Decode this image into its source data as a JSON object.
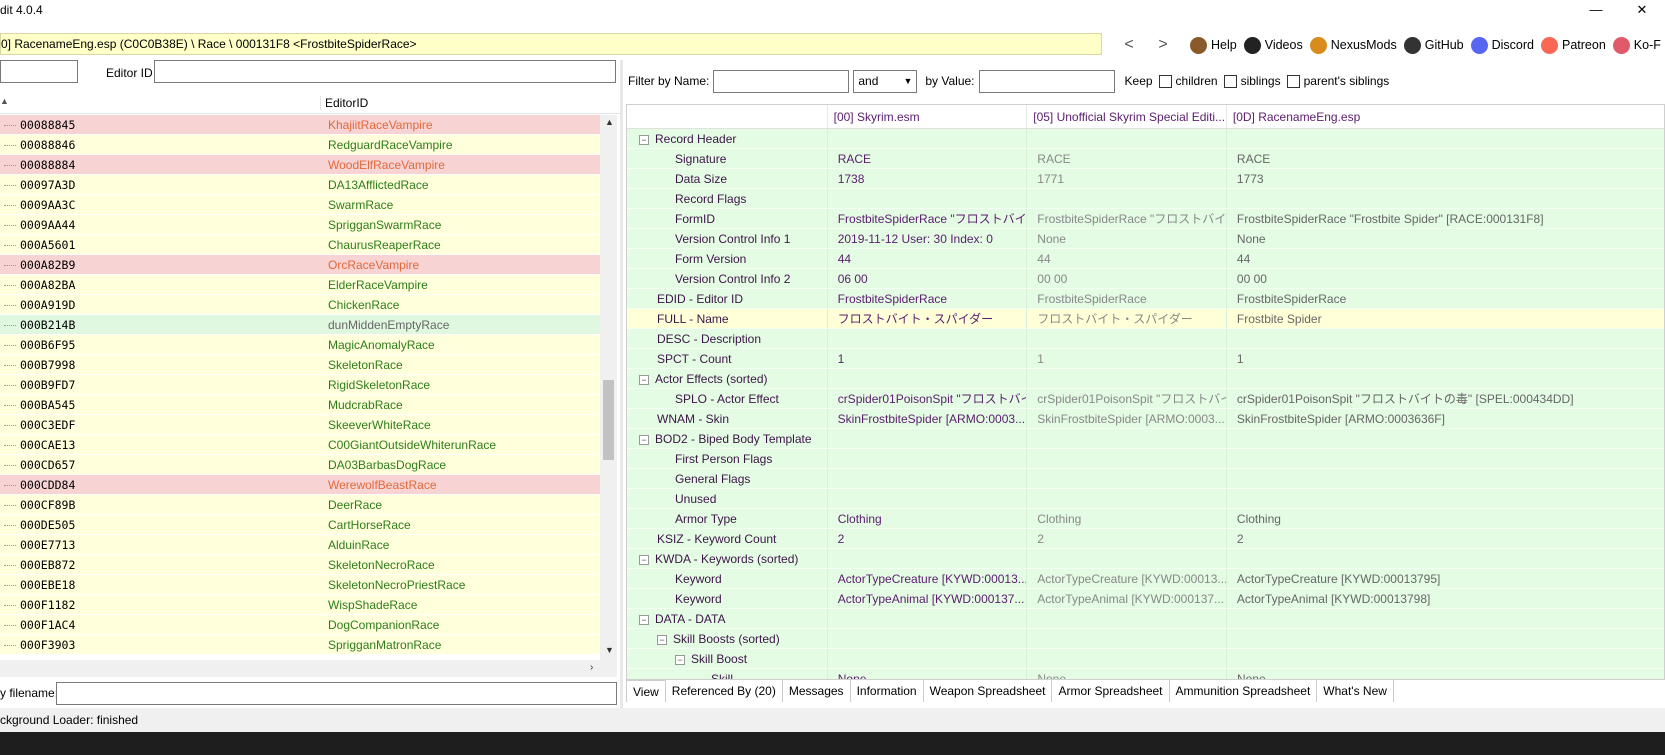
{
  "window": {
    "title": "dit 4.0.4",
    "min": "—",
    "close": "✕"
  },
  "path": "0] RacenameEng.esp (C0C0B38E) \\ Race \\ 000131F8 <FrostbiteSpiderRace>",
  "nav": {
    "back": "<",
    "forward": ">",
    "links": [
      {
        "label": "Help",
        "icon": "book-icon",
        "color": "#8a5a2b"
      },
      {
        "label": "Videos",
        "icon": "gp-icon",
        "color": "#222"
      },
      {
        "label": "NexusMods",
        "icon": "nexus-icon",
        "color": "#d98b1b"
      },
      {
        "label": "GitHub",
        "icon": "github-icon",
        "color": "#333"
      },
      {
        "label": "Discord",
        "icon": "discord-icon",
        "color": "#5865f2"
      },
      {
        "label": "Patreon",
        "icon": "patreon-icon",
        "color": "#f96854"
      },
      {
        "label": "Ko-F",
        "icon": "kofi-icon",
        "color": "#e05a6a"
      }
    ]
  },
  "left": {
    "editor_id_label": "Editor ID",
    "col_header": "EditorID",
    "sort_arrow": "▲",
    "rows": [
      {
        "fid": "00088845",
        "eid": "KhajiitRaceVampire",
        "c": "red"
      },
      {
        "fid": "00088846",
        "eid": "RedguardRaceVampire",
        "c": "yellow"
      },
      {
        "fid": "00088884",
        "eid": "WoodElfRaceVampire",
        "c": "red"
      },
      {
        "fid": "00097A3D",
        "eid": "DA13AfflictedRace",
        "c": "yellow"
      },
      {
        "fid": "0009AA3C",
        "eid": "SwarmRace",
        "c": "yellow"
      },
      {
        "fid": "0009AA44",
        "eid": "SprigganSwarmRace",
        "c": "yellow"
      },
      {
        "fid": "000A5601",
        "eid": "ChaurusReaperRace",
        "c": "yellow"
      },
      {
        "fid": "000A82B9",
        "eid": "OrcRaceVampire",
        "c": "red"
      },
      {
        "fid": "000A82BA",
        "eid": "ElderRaceVampire",
        "c": "yellow"
      },
      {
        "fid": "000A919D",
        "eid": "ChickenRace",
        "c": "yellow"
      },
      {
        "fid": "000B214B",
        "eid": "dunMiddenEmptyRace",
        "c": "green"
      },
      {
        "fid": "000B6F95",
        "eid": "MagicAnomalyRace",
        "c": "yellow"
      },
      {
        "fid": "000B7998",
        "eid": "SkeletonRace",
        "c": "yellow"
      },
      {
        "fid": "000B9FD7",
        "eid": "RigidSkeletonRace",
        "c": "yellow"
      },
      {
        "fid": "000BA545",
        "eid": "MudcrabRace",
        "c": "yellow"
      },
      {
        "fid": "000C3EDF",
        "eid": "SkeeverWhiteRace",
        "c": "yellow"
      },
      {
        "fid": "000CAE13",
        "eid": "C00GiantOutsideWhiterunRace",
        "c": "yellow"
      },
      {
        "fid": "000CD657",
        "eid": "DA03BarbasDogRace",
        "c": "yellow"
      },
      {
        "fid": "000CDD84",
        "eid": "WerewolfBeastRace",
        "c": "red"
      },
      {
        "fid": "000CF89B",
        "eid": "DeerRace",
        "c": "yellow"
      },
      {
        "fid": "000DE505",
        "eid": "CartHorseRace",
        "c": "yellow"
      },
      {
        "fid": "000E7713",
        "eid": "AlduinRace",
        "c": "yellow"
      },
      {
        "fid": "000EB872",
        "eid": "SkeletonNecroRace",
        "c": "yellow"
      },
      {
        "fid": "000EBE18",
        "eid": "SkeletonNecroPriestRace",
        "c": "yellow"
      },
      {
        "fid": "000F1182",
        "eid": "WispShadeRace",
        "c": "yellow"
      },
      {
        "fid": "000F1AC4",
        "eid": "DogCompanionRace",
        "c": "yellow"
      },
      {
        "fid": "000F3903",
        "eid": "SprigganMatronRace",
        "c": "yellow"
      }
    ],
    "filename_label": "y filename:"
  },
  "filter": {
    "name_label": "Filter by Name:",
    "and": "and",
    "value_label": "by Value:",
    "keep": "Keep",
    "children": "children",
    "siblings": "siblings",
    "parents": "parent's siblings"
  },
  "grid": {
    "cols": [
      "[00] Skyrim.esm",
      "[05] Unofficial Skyrim Special Editi...",
      "[0D] RacenameEng.esp"
    ],
    "rows": [
      {
        "n": "Record Header",
        "l": 0,
        "t": "−",
        "v": [
          "",
          "",
          ""
        ]
      },
      {
        "n": "Signature",
        "l": 1,
        "v": [
          "RACE",
          "RACE",
          "RACE"
        ]
      },
      {
        "n": "Data Size",
        "l": 1,
        "v": [
          "1738",
          "1771",
          "1773"
        ]
      },
      {
        "n": "Record Flags",
        "l": 1,
        "v": [
          "",
          "",
          ""
        ]
      },
      {
        "n": "FormID",
        "l": 1,
        "v": [
          "FrostbiteSpiderRace \"フロストバイト...",
          "FrostbiteSpiderRace \"フロストバイト...",
          "FrostbiteSpiderRace \"Frostbite Spider\" [RACE:000131F8]"
        ]
      },
      {
        "n": "Version Control Info 1",
        "l": 1,
        "v": [
          "2019-11-12 User: 30 Index: 0",
          "None",
          "None"
        ]
      },
      {
        "n": "Form Version",
        "l": 1,
        "v": [
          "44",
          "44",
          "44"
        ]
      },
      {
        "n": "Version Control Info 2",
        "l": 1,
        "v": [
          "06 00",
          "00 00",
          "00 00"
        ]
      },
      {
        "n": "EDID - Editor ID",
        "l": 0,
        "v": [
          "FrostbiteSpiderRace",
          "FrostbiteSpiderRace",
          "FrostbiteSpiderRace"
        ]
      },
      {
        "n": "FULL - Name",
        "l": 0,
        "sel": true,
        "v": [
          "フロストバイト・スパイダー",
          "フロストバイト・スパイダー",
          "Frostbite Spider"
        ]
      },
      {
        "n": "DESC - Description",
        "l": 0,
        "v": [
          "",
          "",
          ""
        ]
      },
      {
        "n": "SPCT - Count",
        "l": 0,
        "v": [
          "1",
          "1",
          "1"
        ]
      },
      {
        "n": "Actor Effects (sorted)",
        "l": 0,
        "t": "−",
        "v": [
          "",
          "",
          ""
        ]
      },
      {
        "n": "SPLO - Actor Effect",
        "l": 1,
        "v": [
          "crSpider01PoisonSpit \"フロストバイ...",
          "crSpider01PoisonSpit \"フロストバイ...",
          "crSpider01PoisonSpit \"フロストバイトの毒\" [SPEL:000434DD]"
        ]
      },
      {
        "n": "WNAM - Skin",
        "l": 0,
        "v": [
          "SkinFrostbiteSpider [ARMO:0003...",
          "SkinFrostbiteSpider [ARMO:0003...",
          "SkinFrostbiteSpider [ARMO:0003636F]"
        ]
      },
      {
        "n": "BOD2 - Biped Body Template",
        "l": 0,
        "t": "−",
        "v": [
          "",
          "",
          ""
        ]
      },
      {
        "n": "First Person Flags",
        "l": 1,
        "v": [
          "",
          "",
          ""
        ]
      },
      {
        "n": "General Flags",
        "l": 1,
        "v": [
          "",
          "",
          ""
        ]
      },
      {
        "n": "Unused",
        "l": 1,
        "v": [
          "",
          "",
          ""
        ]
      },
      {
        "n": "Armor Type",
        "l": 1,
        "v": [
          "Clothing",
          "Clothing",
          "Clothing"
        ]
      },
      {
        "n": "KSIZ - Keyword Count",
        "l": 0,
        "v": [
          "2",
          "2",
          "2"
        ]
      },
      {
        "n": "KWDA - Keywords (sorted)",
        "l": 0,
        "t": "−",
        "v": [
          "",
          "",
          ""
        ]
      },
      {
        "n": "Keyword",
        "l": 1,
        "v": [
          "ActorTypeCreature [KYWD:00013...",
          "ActorTypeCreature [KYWD:00013...",
          "ActorTypeCreature [KYWD:00013795]"
        ]
      },
      {
        "n": "Keyword",
        "l": 1,
        "v": [
          "ActorTypeAnimal [KYWD:000137...",
          "ActorTypeAnimal [KYWD:000137...",
          "ActorTypeAnimal [KYWD:00013798]"
        ]
      },
      {
        "n": "DATA - DATA",
        "l": 0,
        "t": "−",
        "v": [
          "",
          "",
          ""
        ]
      },
      {
        "n": "Skill Boosts (sorted)",
        "l": 1,
        "t": "−",
        "v": [
          "",
          "",
          ""
        ]
      },
      {
        "n": "Skill Boost",
        "l": 2,
        "t": "−",
        "v": [
          "",
          "",
          ""
        ]
      },
      {
        "n": "Skill",
        "l": 3,
        "v": [
          "None",
          "None",
          "None"
        ]
      }
    ]
  },
  "tabs": [
    "View",
    "Referenced By (20)",
    "Messages",
    "Information",
    "Weapon Spreadsheet",
    "Armor Spreadsheet",
    "Ammunition Spreadsheet",
    "What's New"
  ],
  "status": "ckground Loader: finished"
}
